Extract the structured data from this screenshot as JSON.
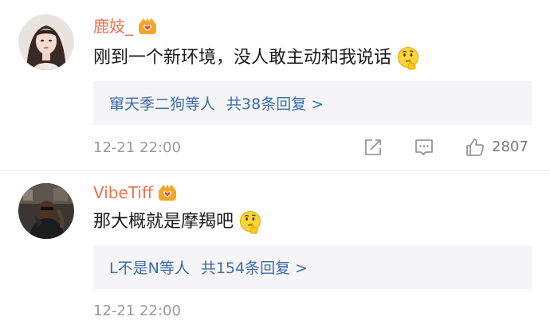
{
  "comments": [
    {
      "username": "鹿妓_",
      "text": "刚到一个新环境，没人敢主动和我说话",
      "reply": {
        "names": "窜天季二狗",
        "etc": "等人",
        "count": "共38条回复 >"
      },
      "timestamp": "12-21 22:00",
      "likes": "2807"
    },
    {
      "username": "VibeTiff",
      "text": "那大概就是摩羯吧",
      "reply": {
        "names": "L不是N",
        "etc": "等人",
        "count": "共154条回复 >"
      },
      "timestamp": "12-21 22:00",
      "likes": ""
    }
  ],
  "icons": {
    "badge": "crown-badge-icon",
    "emoji": "thinking-emoji-icon",
    "share": "share-icon",
    "comment": "comment-icon",
    "like": "thumbs-up-icon"
  },
  "colors": {
    "username": "#eb7350",
    "link": "#3d6ca8",
    "reply_bg": "#f5f5f7",
    "muted": "#9a9a9a"
  }
}
